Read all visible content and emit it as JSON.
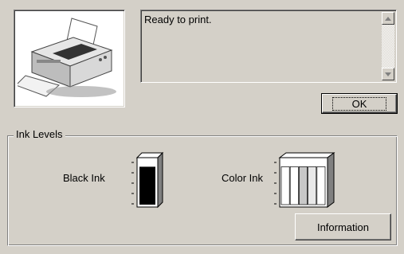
{
  "status": {
    "message": "Ready to print."
  },
  "buttons": {
    "ok_label": "OK",
    "info_label": "Information"
  },
  "ink_levels": {
    "group_title": "Ink Levels",
    "black_label": "Black Ink",
    "color_label": "Color Ink",
    "black_level": 0.85,
    "color_levels": [
      {
        "color": "#ffffff",
        "level": 0.85
      },
      {
        "color": "#ffffff",
        "level": 0.85
      },
      {
        "color": "#c8c8c8",
        "level": 0.85
      },
      {
        "color": "#e8e8e8",
        "level": 0.85
      },
      {
        "color": "#ffffff",
        "level": 0.85
      }
    ]
  },
  "icons": {
    "printer": "printer-icon",
    "scroll_up": "scroll-up-arrow-icon",
    "scroll_down": "scroll-down-arrow-icon"
  },
  "colors": {
    "window_bg": "#d4d0c8",
    "black_ink": "#000000"
  }
}
